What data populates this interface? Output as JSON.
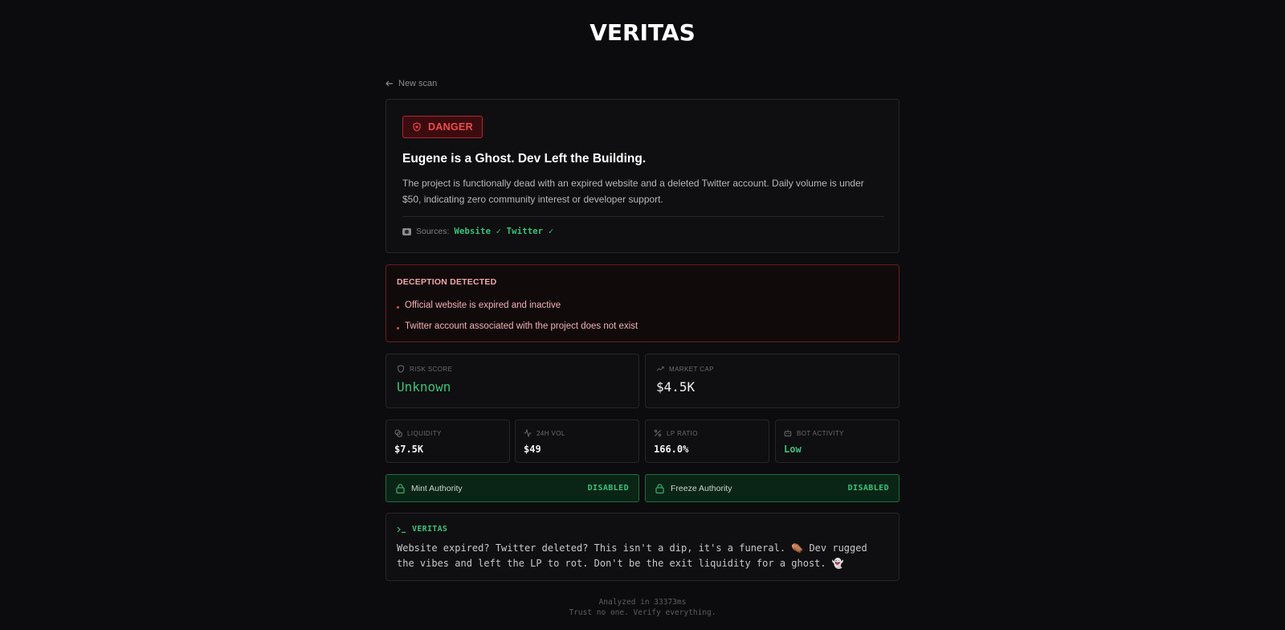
{
  "app": {
    "title": "VERITAS"
  },
  "nav": {
    "back_label": "New scan"
  },
  "summary": {
    "badge": "DANGER",
    "headline": "Eugene is a Ghost. Dev Left the Building.",
    "description": "The project is functionally dead with an expired website and a deleted Twitter account. Daily volume is under $50, indicating zero community interest or developer support.",
    "sources_label": "Sources:",
    "sources_value": "Website ✓ Twitter ✓"
  },
  "deception": {
    "title": "DECEPTION DETECTED",
    "items": [
      "Official website is expired and inactive",
      "Twitter account associated with the project does not exist"
    ]
  },
  "stats_primary": [
    {
      "label": "RISK SCORE",
      "value": "Unknown",
      "icon": "shield-icon"
    },
    {
      "label": "MARKET CAP",
      "value": "$4.5K",
      "icon": "trending-up-icon"
    }
  ],
  "stats_secondary": [
    {
      "label": "LIQUIDITY",
      "value": "$7.5K",
      "icon": "coins-icon"
    },
    {
      "label": "24H VOL",
      "value": "$49",
      "icon": "activity-icon"
    },
    {
      "label": "LP RATIO",
      "value": "166.0%",
      "icon": "percent-icon"
    },
    {
      "label": "BOT ACTIVITY",
      "value": "Low",
      "icon": "bot-icon"
    }
  ],
  "authorities": [
    {
      "label": "Mint Authority",
      "state": "DISABLED"
    },
    {
      "label": "Freeze Authority",
      "state": "DISABLED"
    }
  ],
  "verdict": {
    "title": "VERITAS",
    "text": "Website expired? Twitter deleted? This isn't a dip, it's a funeral. ⚰️ Dev rugged the vibes and left the LP to rot. Don't be the exit liquidity for a ghost. 👻"
  },
  "footer": {
    "analyzed": "Analyzed in 33373ms",
    "tagline": "Trust no one. Verify everything."
  },
  "colors": {
    "background": "#0c0c0e",
    "danger": "#f04a4f",
    "success": "#39c27a"
  }
}
